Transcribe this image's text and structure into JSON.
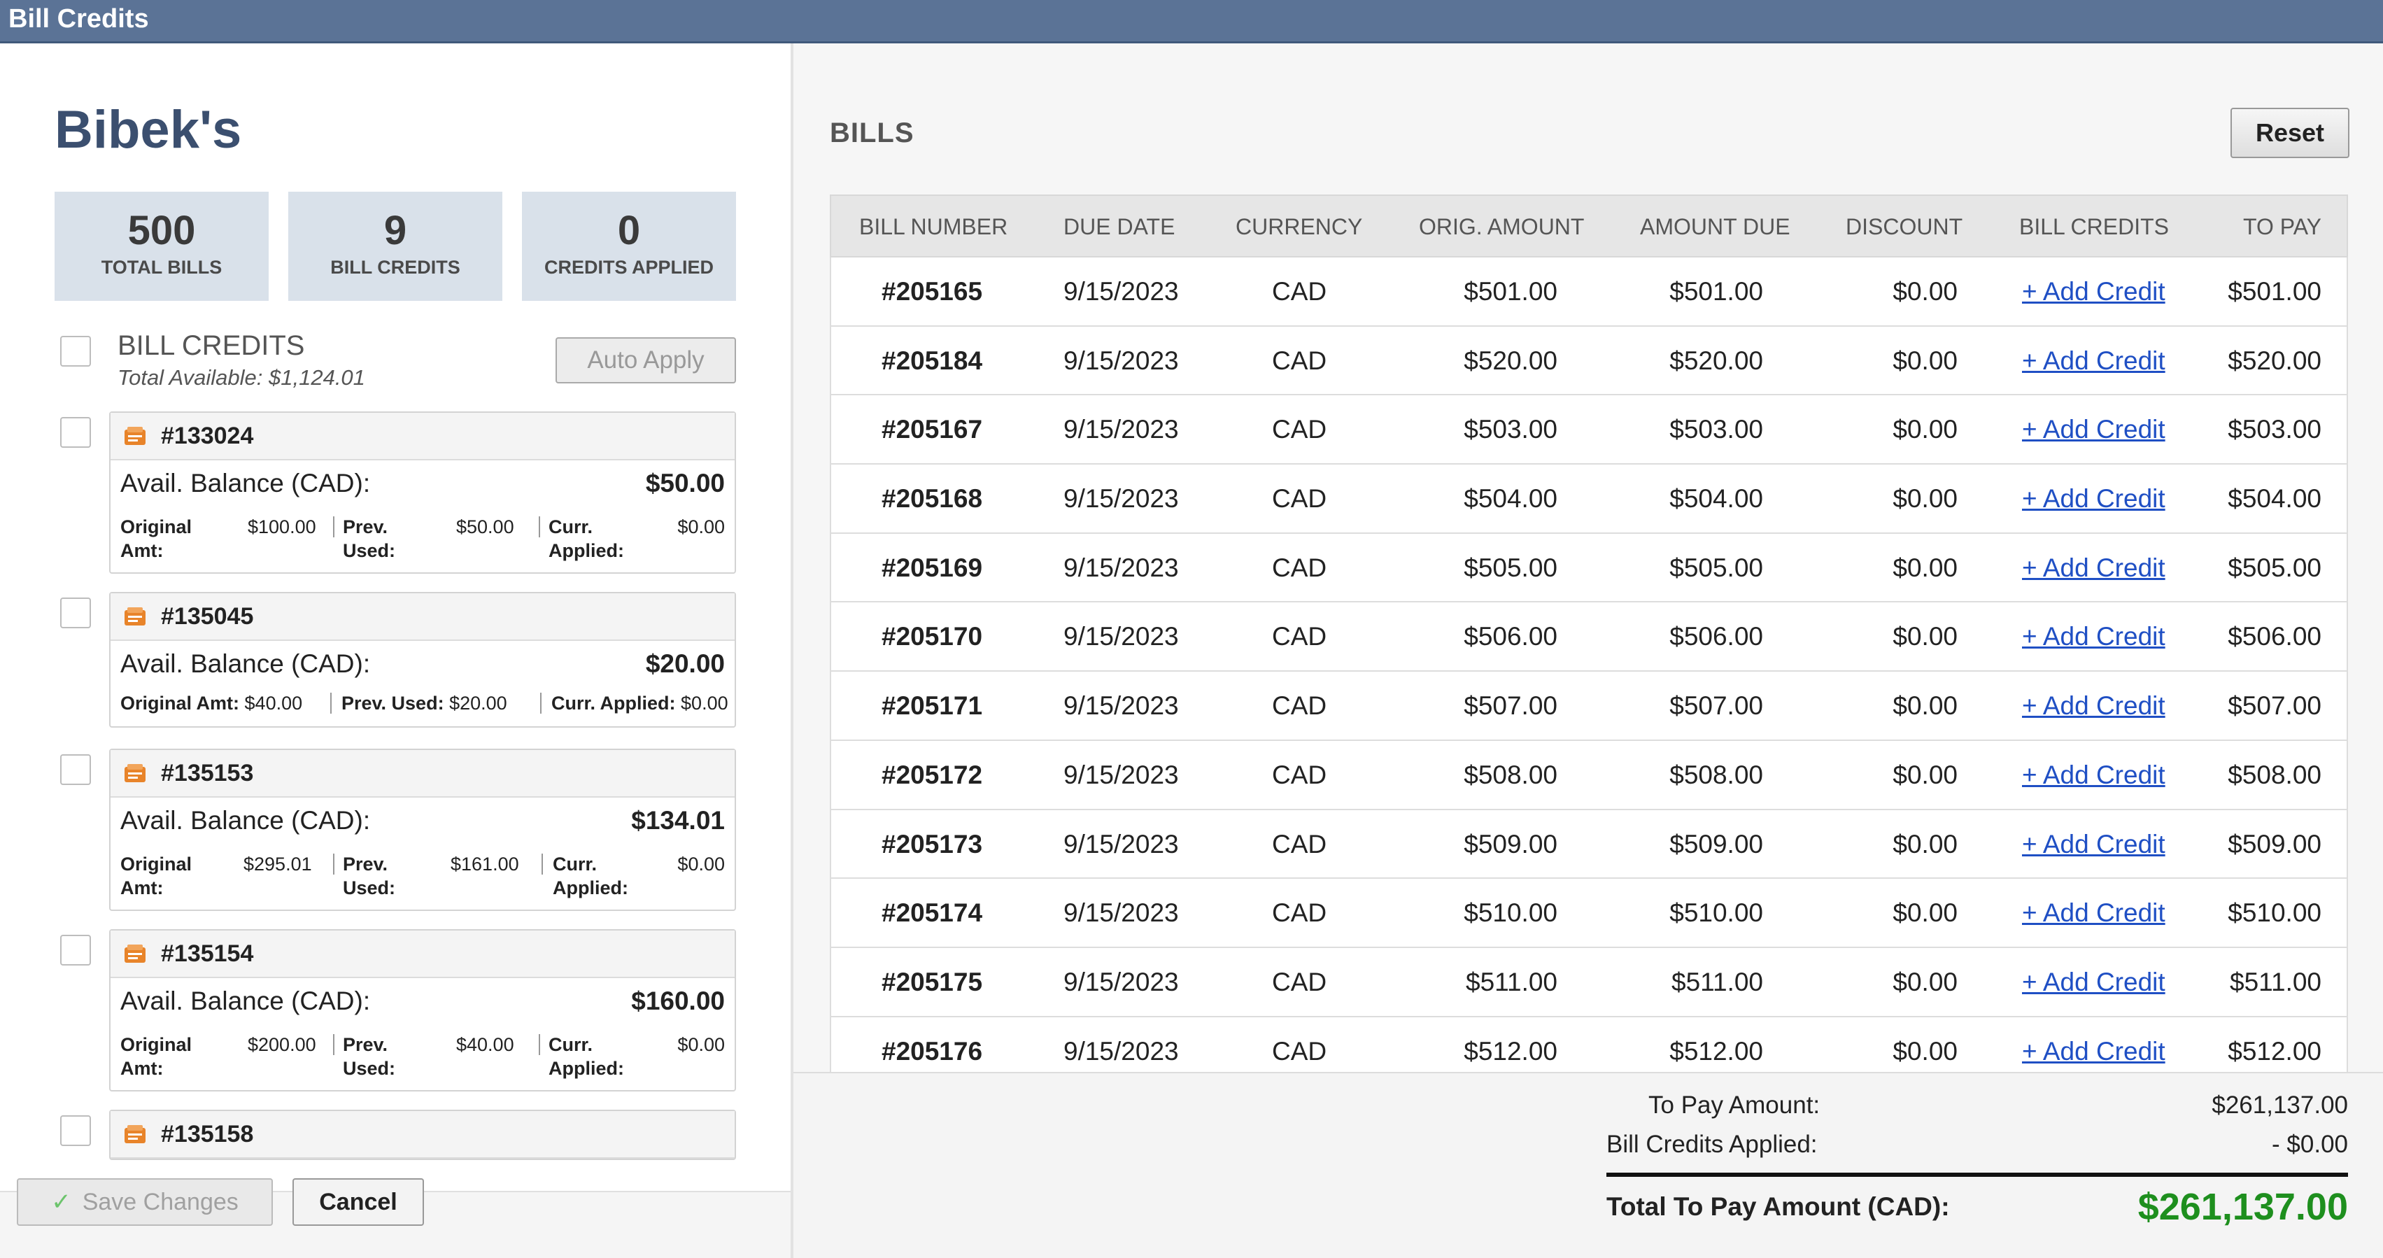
{
  "window": {
    "title": "Bill Credits"
  },
  "vendor": {
    "name": "Bibek's"
  },
  "stats": [
    {
      "value": "500",
      "label": "TOTAL BILLS"
    },
    {
      "value": "9",
      "label": "BILL CREDITS"
    },
    {
      "value": "0",
      "label": "CREDITS APPLIED"
    }
  ],
  "bill_credits": {
    "header": "BILL CREDITS",
    "total_available": "Total Available: $1,124.01",
    "auto_apply_label": "Auto Apply",
    "cards": [
      {
        "number": "#133024",
        "avail_label": "Avail. Balance (CAD):",
        "avail_value": "$50.00",
        "orig_label": "Original Amt:",
        "orig_value": "$100.00",
        "prev_label": "Prev. Used:",
        "prev_value": "$50.00",
        "curr_label": "Curr. Applied:",
        "curr_value": "$0.00"
      },
      {
        "number": "#135045",
        "avail_label": "Avail. Balance (CAD):",
        "avail_value": "$20.00",
        "orig_label": "Original Amt:",
        "orig_value": "$40.00",
        "prev_label": "Prev. Used:",
        "prev_value": "$20.00",
        "curr_label": "Curr. Applied:",
        "curr_value": "$0.00"
      },
      {
        "number": "#135153",
        "avail_label": "Avail. Balance (CAD):",
        "avail_value": "$134.01",
        "orig_label": "Original Amt:",
        "orig_value": "$295.01",
        "prev_label": "Prev. Used:",
        "prev_value": "$161.00",
        "curr_label": "Curr. Applied:",
        "curr_value": "$0.00"
      },
      {
        "number": "#135154",
        "avail_label": "Avail. Balance (CAD):",
        "avail_value": "$160.00",
        "orig_label": "Original Amt:",
        "orig_value": "$200.00",
        "prev_label": "Prev. Used:",
        "prev_value": "$40.00",
        "curr_label": "Curr. Applied:",
        "curr_value": "$0.00"
      },
      {
        "number": "#135158"
      }
    ]
  },
  "footer": {
    "save_label": "Save Changes",
    "cancel_label": "Cancel"
  },
  "bills": {
    "title": "BILLS",
    "reset_label": "Reset",
    "columns": [
      "BILL NUMBER",
      "DUE DATE",
      "CURRENCY",
      "ORIG. AMOUNT",
      "AMOUNT DUE",
      "DISCOUNT",
      "BILL CREDITS",
      "TO PAY"
    ],
    "rows": [
      {
        "number": "#205165",
        "due": "9/15/2023",
        "currency": "CAD",
        "orig": "$501.00",
        "amount_due": "$501.00",
        "discount": "$0.00",
        "credit_link": "+ Add Credit",
        "to_pay": "$501.00"
      },
      {
        "number": "#205184",
        "due": "9/15/2023",
        "currency": "CAD",
        "orig": "$520.00",
        "amount_due": "$520.00",
        "discount": "$0.00",
        "credit_link": "+ Add Credit",
        "to_pay": "$520.00"
      },
      {
        "number": "#205167",
        "due": "9/15/2023",
        "currency": "CAD",
        "orig": "$503.00",
        "amount_due": "$503.00",
        "discount": "$0.00",
        "credit_link": "+ Add Credit",
        "to_pay": "$503.00"
      },
      {
        "number": "#205168",
        "due": "9/15/2023",
        "currency": "CAD",
        "orig": "$504.00",
        "amount_due": "$504.00",
        "discount": "$0.00",
        "credit_link": "+ Add Credit",
        "to_pay": "$504.00"
      },
      {
        "number": "#205169",
        "due": "9/15/2023",
        "currency": "CAD",
        "orig": "$505.00",
        "amount_due": "$505.00",
        "discount": "$0.00",
        "credit_link": "+ Add Credit",
        "to_pay": "$505.00"
      },
      {
        "number": "#205170",
        "due": "9/15/2023",
        "currency": "CAD",
        "orig": "$506.00",
        "amount_due": "$506.00",
        "discount": "$0.00",
        "credit_link": "+ Add Credit",
        "to_pay": "$506.00"
      },
      {
        "number": "#205171",
        "due": "9/15/2023",
        "currency": "CAD",
        "orig": "$507.00",
        "amount_due": "$507.00",
        "discount": "$0.00",
        "credit_link": "+ Add Credit",
        "to_pay": "$507.00"
      },
      {
        "number": "#205172",
        "due": "9/15/2023",
        "currency": "CAD",
        "orig": "$508.00",
        "amount_due": "$508.00",
        "discount": "$0.00",
        "credit_link": "+ Add Credit",
        "to_pay": "$508.00"
      },
      {
        "number": "#205173",
        "due": "9/15/2023",
        "currency": "CAD",
        "orig": "$509.00",
        "amount_due": "$509.00",
        "discount": "$0.00",
        "credit_link": "+ Add Credit",
        "to_pay": "$509.00"
      },
      {
        "number": "#205174",
        "due": "9/15/2023",
        "currency": "CAD",
        "orig": "$510.00",
        "amount_due": "$510.00",
        "discount": "$0.00",
        "credit_link": "+ Add Credit",
        "to_pay": "$510.00"
      },
      {
        "number": "#205175",
        "due": "9/15/2023",
        "currency": "CAD",
        "orig": "$511.00",
        "amount_due": "$511.00",
        "discount": "$0.00",
        "credit_link": "+ Add Credit",
        "to_pay": "$511.00"
      },
      {
        "number": "#205176",
        "due": "9/15/2023",
        "currency": "CAD",
        "orig": "$512.00",
        "amount_due": "$512.00",
        "discount": "$0.00",
        "credit_link": "+ Add Credit",
        "to_pay": "$512.00"
      }
    ]
  },
  "totals": {
    "to_pay_label": "To Pay Amount:",
    "to_pay_value": "$261,137.00",
    "credits_applied_label": "Bill Credits Applied:",
    "credits_applied_value": "- $0.00",
    "grand_label": "Total To Pay Amount (CAD):",
    "grand_value": "$261,137.00"
  },
  "colors": {
    "titlebar": "#5b7396",
    "link": "#1f4fc4",
    "grand_total": "#1e8f1e",
    "stat_bg": "#d9e1ea",
    "bill_icon": "#e8842a"
  }
}
